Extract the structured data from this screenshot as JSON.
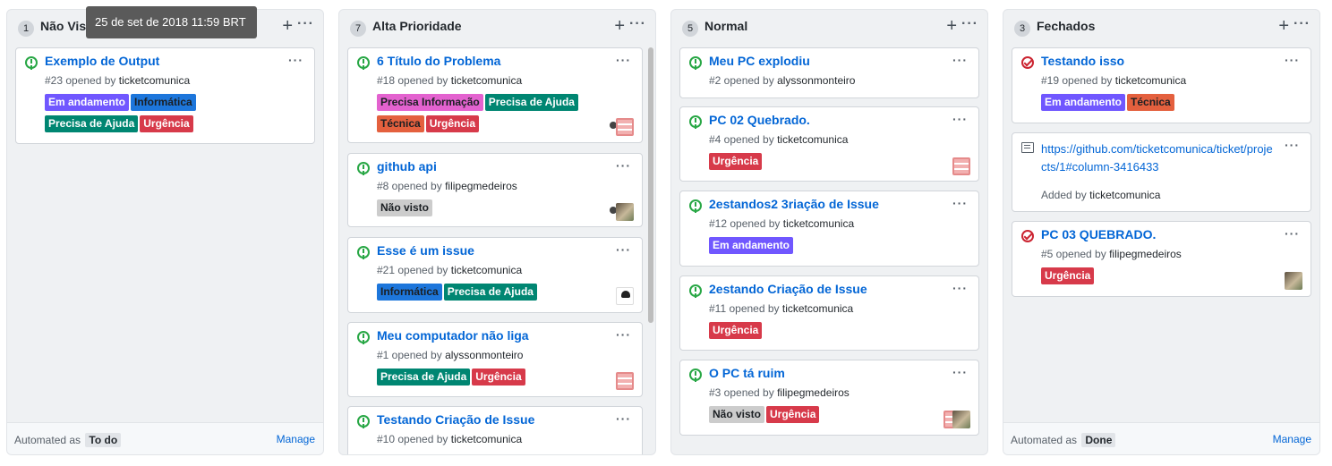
{
  "tooltip": "25 de set de 2018 11:59 BRT",
  "colors": {
    "purple": "#7057ff",
    "blue": "#0e8fc7",
    "teal": "#008672",
    "red": "#d73a4a",
    "pink": "#e362cf",
    "orange": "#e4603e",
    "gray": "#cccccc"
  },
  "columns": [
    {
      "count": "1",
      "name": "Não Visto",
      "plus": "+",
      "more": "···",
      "cards": [
        {
          "title": "Exemplo de Output",
          "ref": "#23 opened by",
          "author": "ticketcomunica",
          "more": "···",
          "labels": [
            {
              "text": "Em andamento",
              "color": "#7057ff"
            },
            {
              "text": "Informática",
              "color": "#1d76db"
            },
            {
              "text": "Precisa de Ajuda",
              "color": "#008672"
            },
            {
              "text": "Urgência",
              "color": "#d73a4a"
            }
          ]
        }
      ],
      "footer": {
        "automated": "Automated as",
        "chip": "To do",
        "manage": "Manage"
      }
    },
    {
      "count": "7",
      "name": "Alta Prioridade",
      "plus": "+",
      "more": "···",
      "cards": [
        {
          "title": "6 Título do Problema",
          "ref": "#18 opened by",
          "author": "ticketcomunica",
          "more": "···",
          "labels": [
            {
              "text": "Precisa Informação",
              "color": "#e362cf"
            },
            {
              "text": "Precisa de Ajuda",
              "color": "#008672"
            },
            {
              "text": "Técnica",
              "color": "#e4603e"
            },
            {
              "text": "Urgência",
              "color": "#d73a4a"
            }
          ]
        },
        {
          "title": "github api",
          "ref": "#8 opened by",
          "author": "filipegmedeiros",
          "more": "···",
          "labels": [
            {
              "text": "Não visto",
              "color": "#cccccc"
            }
          ]
        },
        {
          "title": "Esse é um issue",
          "ref": "#21 opened by",
          "author": "ticketcomunica",
          "more": "···",
          "labels": [
            {
              "text": "Informática",
              "color": "#1d76db"
            },
            {
              "text": "Precisa de Ajuda",
              "color": "#008672"
            }
          ]
        },
        {
          "title": "Meu computador não liga",
          "ref": "#1 opened by",
          "author": "alyssonmonteiro",
          "more": "···",
          "labels": [
            {
              "text": "Precisa de Ajuda",
              "color": "#008672"
            },
            {
              "text": "Urgência",
              "color": "#d73a4a"
            }
          ]
        },
        {
          "title": "Testando Criação de Issue",
          "ref": "#10 opened by",
          "author": "ticketcomunica",
          "more": "···",
          "labels": []
        }
      ]
    },
    {
      "count": "5",
      "name": "Normal",
      "plus": "+",
      "more": "···",
      "cards": [
        {
          "title": "Meu PC explodiu",
          "ref": "#2 opened by",
          "author": "alyssonmonteiro",
          "more": "···",
          "labels": []
        },
        {
          "title": "PC 02 Quebrado.",
          "ref": "#4 opened by",
          "author": "ticketcomunica",
          "more": "···",
          "labels": [
            {
              "text": "Urgência",
              "color": "#d73a4a"
            }
          ]
        },
        {
          "title": "2estandos2 3riação de Issue",
          "ref": "#12 opened by",
          "author": "ticketcomunica",
          "more": "···",
          "labels": [
            {
              "text": "Em andamento",
              "color": "#7057ff"
            }
          ]
        },
        {
          "title": "2estando Criação de Issue",
          "ref": "#11 opened by",
          "author": "ticketcomunica",
          "more": "···",
          "labels": [
            {
              "text": "Urgência",
              "color": "#d73a4a"
            }
          ]
        },
        {
          "title": "O PC tá ruim",
          "ref": "#3 opened by",
          "author": "filipegmedeiros",
          "more": "···",
          "labels": [
            {
              "text": "Não visto",
              "color": "#cccccc"
            },
            {
              "text": "Urgência",
              "color": "#d73a4a"
            }
          ]
        }
      ]
    },
    {
      "count": "3",
      "name": "Fechados",
      "plus": "+",
      "more": "···",
      "cards": [
        {
          "title": "Testando isso",
          "ref": "#19 opened by",
          "author": "ticketcomunica",
          "more": "···",
          "labels": [
            {
              "text": "Em andamento",
              "color": "#7057ff"
            },
            {
              "text": "Técnica",
              "color": "#e4603e"
            }
          ]
        },
        {
          "note": true,
          "link": "https://github.com/ticketcomunica/ticket/projects/1#column-3416433",
          "added": "Added by",
          "author": "ticketcomunica",
          "more": "···"
        },
        {
          "title": "PC 03 QUEBRADO.",
          "ref": "#5 opened by",
          "author": "filipegmedeiros",
          "more": "···",
          "labels": [
            {
              "text": "Urgência",
              "color": "#d73a4a"
            }
          ]
        }
      ],
      "footer": {
        "automated": "Automated as",
        "chip": "Done",
        "manage": "Manage"
      }
    }
  ]
}
